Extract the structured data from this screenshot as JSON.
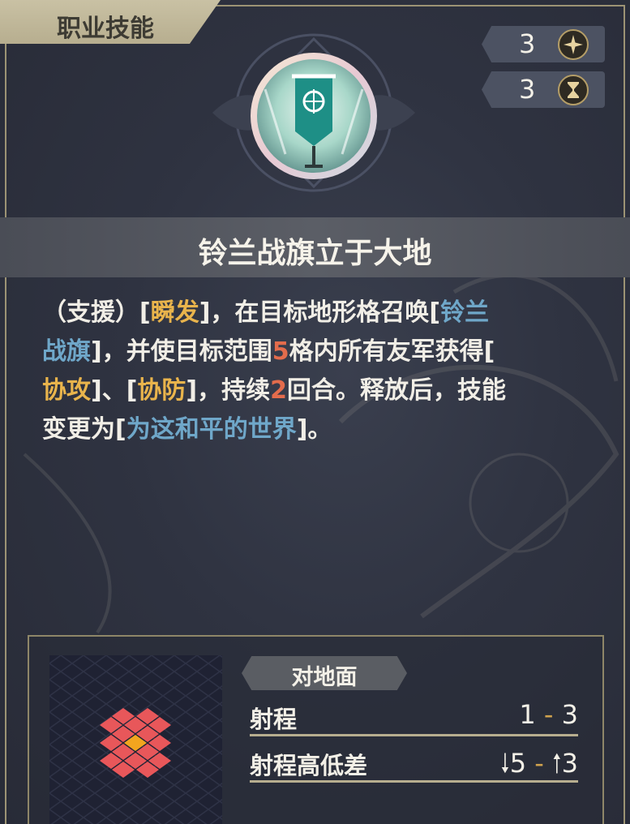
{
  "header": {
    "tab_label": "职业技能"
  },
  "stats": [
    {
      "value": "3",
      "icon": "sparkle-cost-icon"
    },
    {
      "value": "3",
      "icon": "hourglass-cooldown-icon"
    }
  ],
  "skill": {
    "name": "铃兰战旗立于大地",
    "description": {
      "line1": {
        "a": "（支援）[",
        "b": "瞬发",
        "c": "]，在目标地形格召唤[",
        "d": "铃兰"
      },
      "line2": {
        "a": "战旗",
        "b": "]，并使目标范围",
        "c": "5",
        "d": "格内所有友军获得["
      },
      "line3": {
        "a": "协攻",
        "b": "]、[",
        "c": "协防",
        "d": "]，持续",
        "e": "2",
        "f": "回合。释放后，技能"
      },
      "line4": {
        "a": "变更为[",
        "b": "为这和平的世界",
        "c": "]。"
      }
    }
  },
  "range_panel": {
    "target_tab": "对地面",
    "range_label": "射程",
    "range_min": "1",
    "range_sep": "-",
    "range_max": "3",
    "height_label": "射程高低差",
    "height_down": "5",
    "height_sep": "-",
    "height_up": "3"
  },
  "colors": {
    "keyword_blue": "#6fa7c9",
    "keyword_gold": "#e9b44c",
    "number_red": "#e36c4c",
    "frame_gold": "#9c9374",
    "grid_tile": "#e8575a",
    "grid_center": "#f2a51f"
  }
}
